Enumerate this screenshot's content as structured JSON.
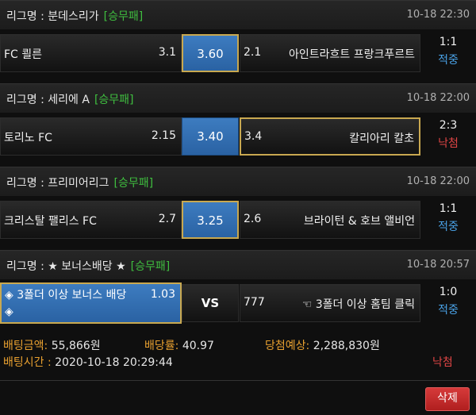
{
  "bets": [
    {
      "league_label": "리그명 : 분데스리가",
      "bet_type": "[승무패]",
      "time": "10-18 22:30",
      "home": "FC 쾰른",
      "home_odds": "3.1",
      "draw_odds": "3.60",
      "away_odds": "2.1",
      "away": "아인트라흐트 프랑크푸르트",
      "score": "1:1",
      "status": "적중"
    },
    {
      "league_label": "리그명 : 세리에 A",
      "bet_type": "[승무패]",
      "time": "10-18 22:00",
      "home": "토리노 FC",
      "home_odds": "2.15",
      "draw_odds": "3.40",
      "away_odds": "3.4",
      "away": "칼리아리 칼초",
      "score": "2:3",
      "status": "낙첨"
    },
    {
      "league_label": "리그명 : 프리미어리그",
      "bet_type": "[승무패]",
      "time": "10-18 22:00",
      "home": "크리스탈 팰리스 FC",
      "home_odds": "2.7",
      "draw_odds": "3.25",
      "away_odds": "2.6",
      "away": "브라이턴 & 호브 앨비언",
      "score": "1:1",
      "status": "적중"
    },
    {
      "league_label": "리그명 : ★ 보너스배당 ★",
      "bet_type": "[승무패]",
      "time": "10-18 20:57",
      "home": "◈ 3폴더 이상 보너스 배당",
      "home_line2": "◈",
      "home_odds": "1.03",
      "draw": "VS",
      "away_odds": "777",
      "away": "☜ 3폴더 이상 홈팀 클릭",
      "score": "1:0",
      "status": "적중"
    }
  ],
  "summary": {
    "bet_amount_label": "배팅금액:",
    "bet_amount": "55,866원",
    "odds_label": "배당률:",
    "odds": "40.97",
    "expected_label": "당첨예상:",
    "expected": "2,288,830원",
    "bet_time_label": "배팅시간 :",
    "bet_time": "2020-10-18 20:29:44",
    "result": "낙첨"
  },
  "actions": {
    "delete": "삭제"
  },
  "colors": {
    "win": "#4aa3e8",
    "lose": "#e04545",
    "tag": "#3fbf3f",
    "label": "#e8a030",
    "selected_border": "#c8a850"
  }
}
